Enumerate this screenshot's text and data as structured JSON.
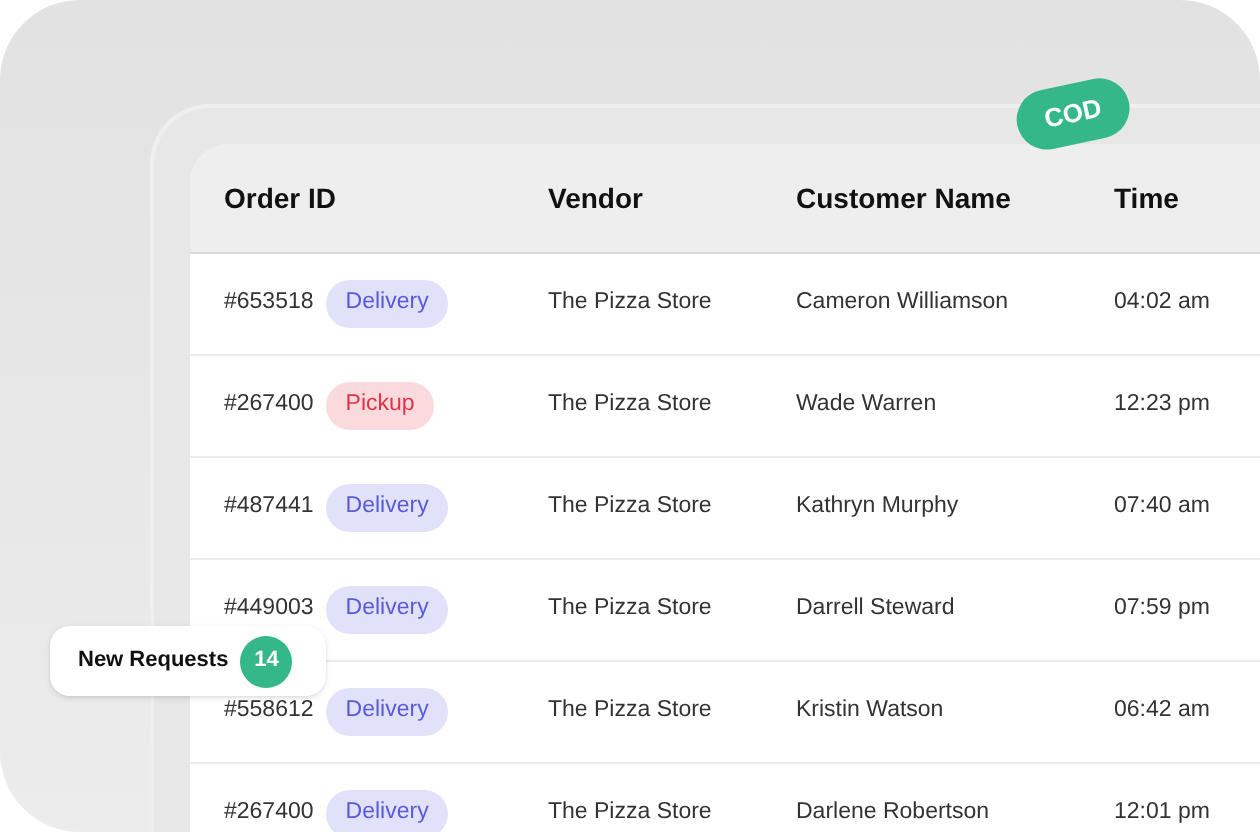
{
  "badge": {
    "label": "COD"
  },
  "table": {
    "columns": [
      "Order ID",
      "Vendor",
      "Customer Name",
      "Time"
    ],
    "rows": [
      {
        "order_id": "#653518",
        "type": {
          "label": "Delivery",
          "kind": "delivery"
        },
        "vendor": "The Pizza Store",
        "customer": "Cameron Williamson",
        "time": "04:02 am"
      },
      {
        "order_id": "#267400",
        "type": {
          "label": "Pickup",
          "kind": "pickup"
        },
        "vendor": "The Pizza Store",
        "customer": "Wade Warren",
        "time": "12:23 pm"
      },
      {
        "order_id": "#487441",
        "type": {
          "label": "Delivery",
          "kind": "delivery"
        },
        "vendor": "The Pizza Store",
        "customer": "Kathryn Murphy",
        "time": "07:40 am"
      },
      {
        "order_id": "#449003",
        "type": {
          "label": "Delivery",
          "kind": "delivery"
        },
        "vendor": "The Pizza Store",
        "customer": "Darrell Steward",
        "time": "07:59 pm"
      },
      {
        "order_id": "#558612",
        "type": {
          "label": "Delivery",
          "kind": "delivery"
        },
        "vendor": "The Pizza Store",
        "customer": "Kristin Watson",
        "time": "06:42 am"
      },
      {
        "order_id": "#267400",
        "type": {
          "label": "Delivery",
          "kind": "delivery"
        },
        "vendor": "The Pizza Store",
        "customer": "Darlene Robertson",
        "time": "12:01 pm"
      }
    ]
  },
  "new_requests": {
    "label": "New Requests",
    "count": "14"
  }
}
